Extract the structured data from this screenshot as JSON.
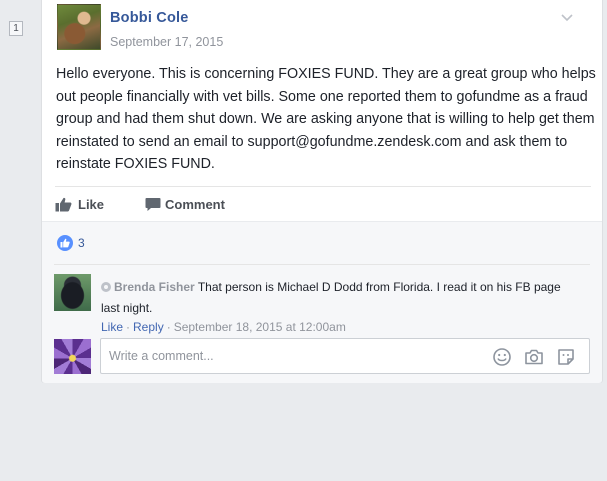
{
  "page_badge": "1",
  "post": {
    "author": "Bobbi Cole",
    "date": "September 17, 2015",
    "body": "Hello everyone. This is concerning FOXIES FUND. They are a great group who helps out people financially with vet bills. Some one reported them to gofundme as a fraud group and had them shut down. We are asking anyone that is willing to help get them reinstated to send an email to support@gofundme.zendesk.com and ask them to reinstate FOXIES FUND.",
    "actions": {
      "like_label": "Like",
      "comment_label": "Comment"
    }
  },
  "reactions": {
    "count": "3",
    "type_icon": "like-icon"
  },
  "comment": {
    "author": "Brenda Fisher",
    "text": "That person is Michael D Dodd from Florida. I read it on his FB page last night.",
    "like_label": "Like",
    "reply_label": "Reply",
    "date": "September 18, 2015 at 12:00am"
  },
  "composer": {
    "placeholder": "Write a comment...",
    "icons": [
      "emoji-icon",
      "camera-icon",
      "sticker-icon"
    ]
  },
  "colors": {
    "link": "#365899",
    "meta": "#90949c",
    "reaction_blue": "#5890ff",
    "background": "#e9ebee"
  }
}
